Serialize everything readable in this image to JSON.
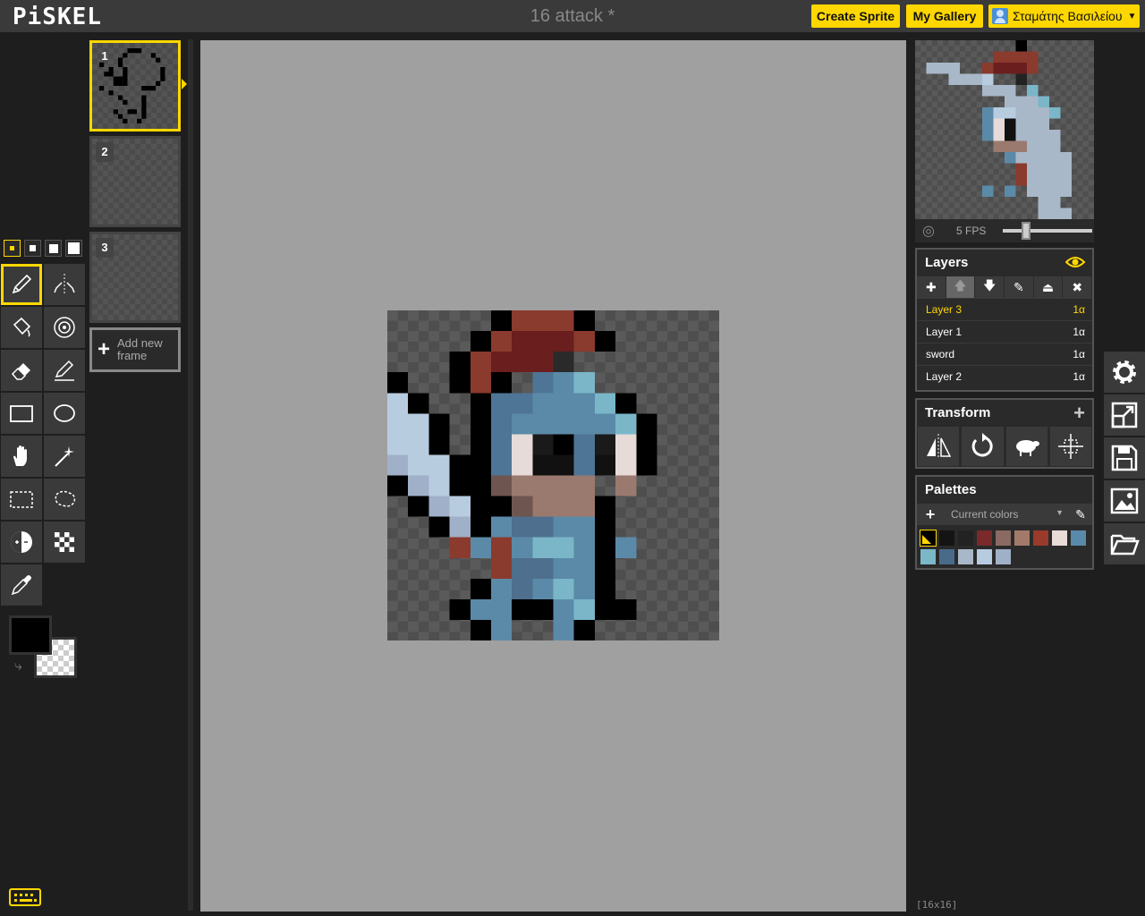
{
  "app": {
    "logo": "PiSKEL",
    "title": "16 attack *"
  },
  "header": {
    "create_sprite": "Create Sprite",
    "my_gallery": "My Gallery",
    "user_name": "Σταμάτης Βασιλείου",
    "user_icon": "user-icon"
  },
  "tools": {
    "pen_sizes": [
      1,
      2,
      3,
      4
    ],
    "selected_pen_size": 1,
    "items": [
      {
        "name": "pen-tool-icon",
        "selected": true
      },
      {
        "name": "vertical-mirror-pen-icon"
      },
      {
        "name": "paint-bucket-icon"
      },
      {
        "name": "paint-same-color-icon"
      },
      {
        "name": "eraser-icon"
      },
      {
        "name": "stroke-line-icon"
      },
      {
        "name": "rectangle-icon"
      },
      {
        "name": "ellipse-icon"
      },
      {
        "name": "move-hand-icon"
      },
      {
        "name": "magic-wand-icon"
      },
      {
        "name": "rectangle-select-icon"
      },
      {
        "name": "lasso-select-icon"
      },
      {
        "name": "lighten-icon"
      },
      {
        "name": "dithering-icon"
      },
      {
        "name": "color-picker-icon"
      }
    ],
    "primary_color": "#000000",
    "secondary_color": "transparent"
  },
  "frames": {
    "items": [
      {
        "number": "1",
        "selected": true
      },
      {
        "number": "2"
      },
      {
        "number": "3"
      }
    ],
    "add_label": "Add new frame"
  },
  "preview": {
    "fps_label": "5 FPS",
    "fps_value": 5
  },
  "layers": {
    "title": "Layers",
    "items": [
      {
        "name": "Layer 3",
        "opacity": "1α",
        "selected": true
      },
      {
        "name": "Layer 1",
        "opacity": "1α"
      },
      {
        "name": "sword",
        "opacity": "1α"
      },
      {
        "name": "Layer 2",
        "opacity": "1α"
      }
    ]
  },
  "transform": {
    "title": "Transform",
    "tools": [
      "flip-icon",
      "rotate-icon",
      "clone-sheep-icon",
      "center-icon"
    ]
  },
  "palettes": {
    "title": "Palettes",
    "selected": "Current colors",
    "colors": [
      "#000000",
      "#141414",
      "#222222",
      "#7a2a2a",
      "#8a6a62",
      "#a27a6a",
      "#9a3a2a",
      "#e8dcd8",
      "#5a8aaa",
      "#7ab8c8",
      "#4a6a8a",
      "#a8b8c8",
      "#b8cce0",
      "#a0b0c8"
    ],
    "accent": "#ffd700"
  },
  "side_buttons": [
    "settings-icon",
    "resize-icon",
    "save-icon",
    "export-image-icon",
    "import-folder-icon"
  ],
  "status": {
    "size": "[16x16]"
  }
}
